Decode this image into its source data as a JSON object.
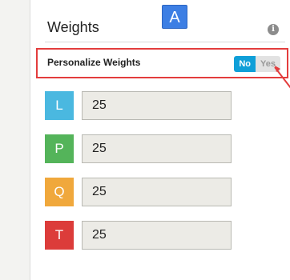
{
  "header": {
    "title": "Weights",
    "annotation_label": "A",
    "info_icon": "info-icon",
    "info_glyph": "i"
  },
  "personalize": {
    "label": "Personalize Weights",
    "toggle": {
      "options": [
        "No",
        "Yes"
      ],
      "selected": "No",
      "selected_color": "#0f9fd8"
    }
  },
  "weights": [
    {
      "letter": "L",
      "value": "25",
      "color": "#4ab8e0"
    },
    {
      "letter": "P",
      "value": "25",
      "color": "#54b45a"
    },
    {
      "letter": "Q",
      "value": "25",
      "color": "#f0a83c"
    },
    {
      "letter": "T",
      "value": "25",
      "color": "#dc3c3a"
    }
  ],
  "highlight_color": "#e33d3d"
}
